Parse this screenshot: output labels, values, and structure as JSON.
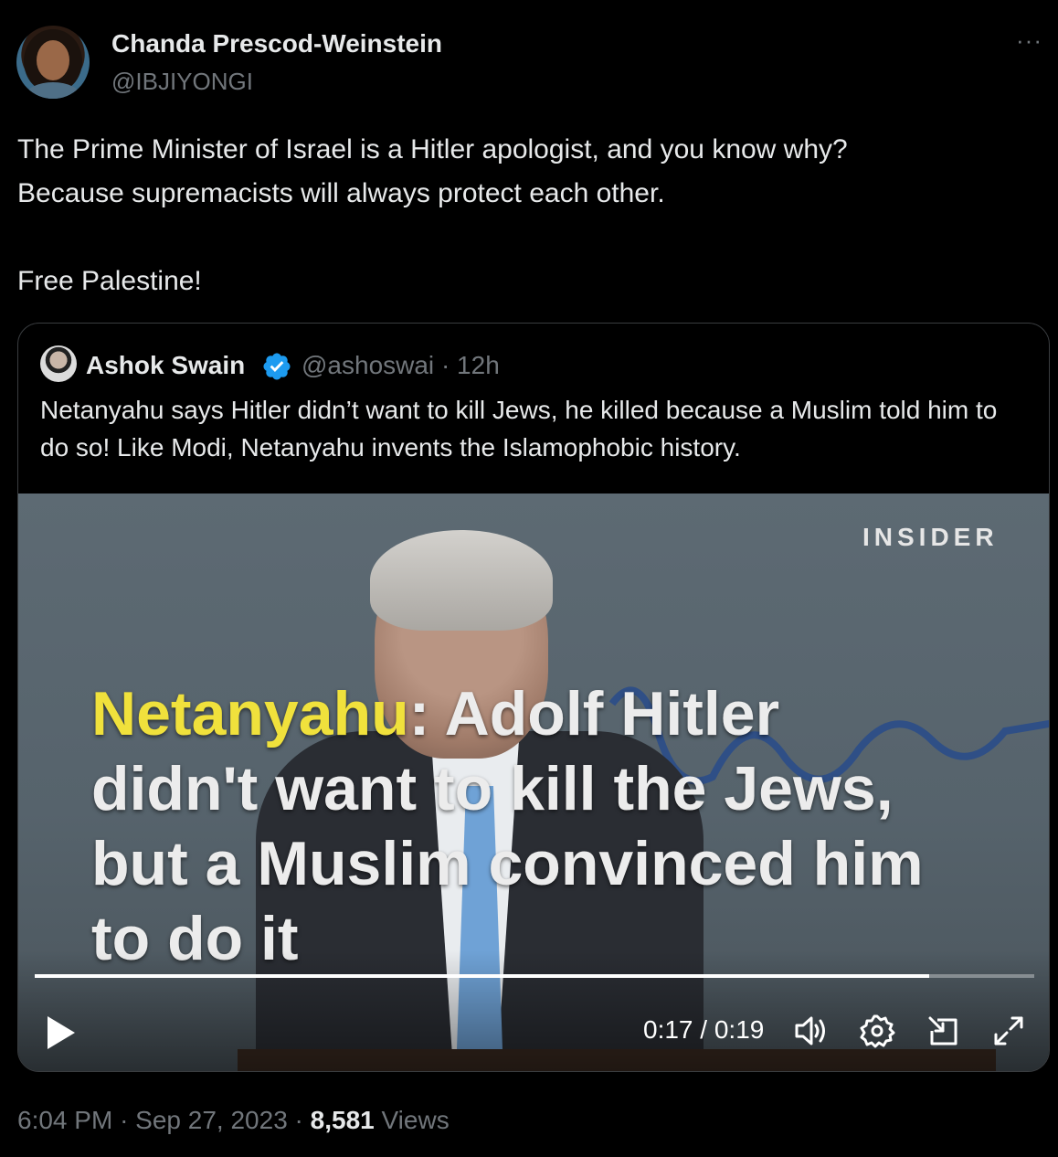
{
  "tweet": {
    "author_name": "Chanda Prescod-Weinstein",
    "author_handle": "@IBJIYONGI",
    "more_label": "···",
    "text_line1": "The Prime Minister of Israel is a Hitler apologist, and you know why?",
    "text_line2": "Because supremacists will always protect each other.",
    "text_line3": "Free Palestine!",
    "time": "6:04 PM",
    "date": "Sep 27, 2023",
    "views_count": "8,581",
    "views_label": "Views",
    "separator": "·"
  },
  "quote": {
    "author_name": "Ashok Swain",
    "author_handle": "@ashoswai",
    "age": "12h",
    "separator": "·",
    "text": "Netanyahu says Hitler didn’t want to kill Jews, he killed because a Muslim told him to do so! Like Modi, Netanyahu invents the Islamophobic history."
  },
  "video": {
    "brand": "INSIDER",
    "caption_highlight": "Netanyahu",
    "caption_rest": ": Adolf Hitler didn't want to kill the Jews, but a Muslim convinced him to do it",
    "current_time": "0:17",
    "duration": "0:19",
    "time_separator": " / ",
    "progress_fraction": 0.8947
  },
  "icons": {
    "play": "play-icon",
    "volume": "volume-icon",
    "settings": "gear-icon",
    "pip": "picture-in-picture-icon",
    "fullscreen": "fullscreen-icon",
    "verified": "verified-badge-icon"
  },
  "colors": {
    "background": "#000000",
    "text_primary": "#e7e9ea",
    "text_secondary": "#71767b",
    "verified_blue": "#1d9bf0",
    "caption_highlight": "#f0e13c"
  }
}
